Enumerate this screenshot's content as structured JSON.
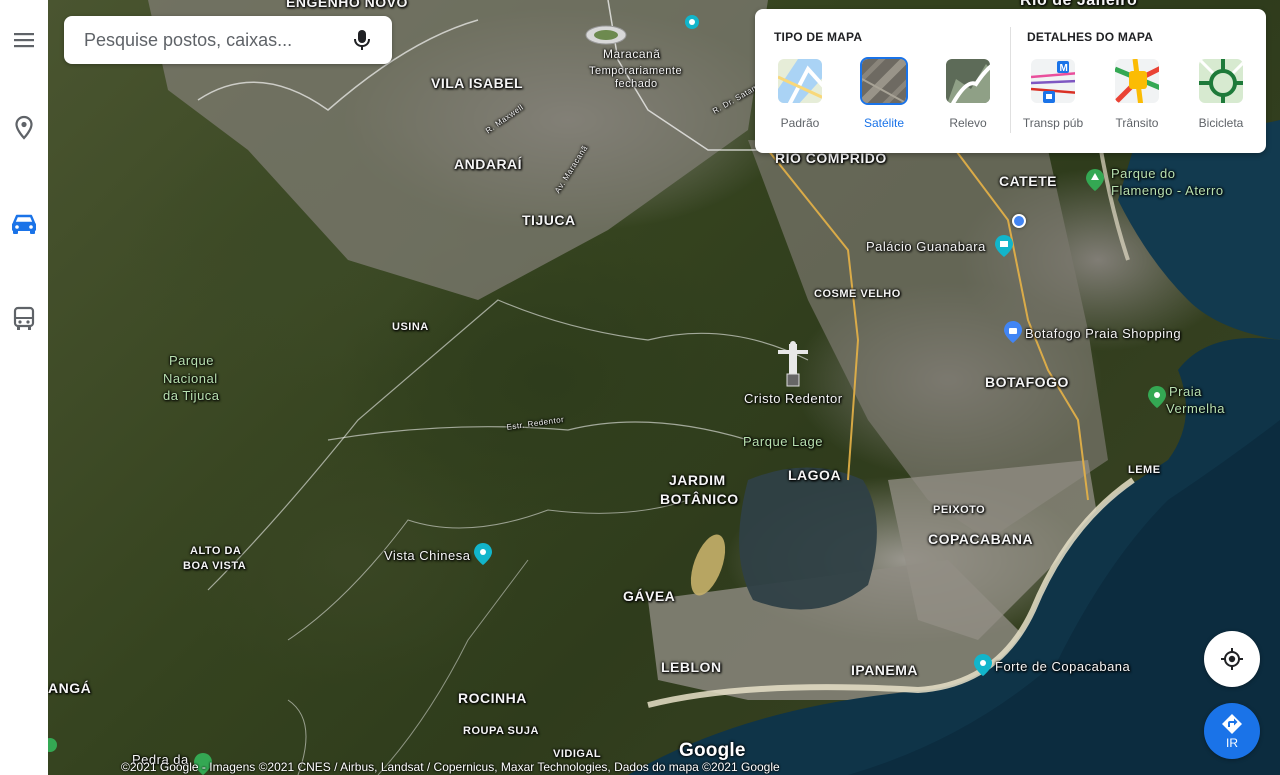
{
  "search": {
    "placeholder": "Pesquise postos, caixas..."
  },
  "rail": {
    "items": [
      {
        "name": "menu",
        "icon": "menu-icon"
      },
      {
        "name": "explore",
        "icon": "location-pin-icon"
      },
      {
        "name": "driving",
        "icon": "car-icon",
        "active": true
      },
      {
        "name": "transit",
        "icon": "bus-icon"
      }
    ]
  },
  "layers": {
    "map_type_title": "TIPO DE MAPA",
    "map_details_title": "DETALHES DO MAPA",
    "map_types": [
      {
        "label": "Padrão"
      },
      {
        "label": "Satélite",
        "selected": true
      },
      {
        "label": "Relevo"
      }
    ],
    "details": [
      {
        "label": "Transp púb"
      },
      {
        "label": "Trânsito"
      },
      {
        "label": "Bicicleta"
      }
    ]
  },
  "map": {
    "neighborhoods": [
      "ENGENHO NOVO",
      "VILA ISABEL",
      "ANDARAÍ",
      "TIJUCA",
      "RIO COMPRIDO",
      "CATETE",
      "COSME VELHO",
      "USINA",
      "BOTAFOGO",
      "JARDIM",
      "BOTÂNICO",
      "LAGOA",
      "LEME",
      "PEIXOTO",
      "COPACABANA",
      "ALTO DA",
      "BOA VISTA",
      "GÁVEA",
      "LEBLON",
      "IPANEMA",
      "ROCINHA",
      "ROUPA SUJA",
      "VIDIGAL",
      "ANGÁ",
      "Rio de Janeiro"
    ],
    "pois": {
      "maracana": "Maracanã",
      "maracana_status_1": "Temporariamente",
      "maracana_status_2": "fechado",
      "flamengo_1": "Parque do",
      "flamengo_2": "Flamengo - Aterro",
      "guanabara": "Palácio Guanabara",
      "botafogo_shopping": "Botafogo Praia Shopping",
      "praia_vermelha_1": "Praia",
      "praia_vermelha_2": "Vermelha",
      "cristo": "Cristo Redentor",
      "parque_lage": "Parque Lage",
      "tijuca_park_1": "Parque",
      "tijuca_park_2": "Nacional",
      "tijuca_park_3": "da Tijuca",
      "vista_chinesa": "Vista Chinesa",
      "forte": "Forte de Copacabana",
      "pedra": "Pedra da"
    },
    "roads": [
      "R. Maxwell",
      "Av. Maracanã",
      "R. Dr. Satamini",
      "Estr. Redentor"
    ]
  },
  "controls": {
    "go_label": "IR"
  },
  "footer": {
    "logo": "Google",
    "attribution": "©2021 Google - Imagens ©2021 CNES / Airbus, Landsat / Copernicus, Maxar Technologies, Dados do mapa ©2021 Google"
  },
  "colors": {
    "accent": "#1a73e8",
    "icon_gray": "#5f6368"
  }
}
